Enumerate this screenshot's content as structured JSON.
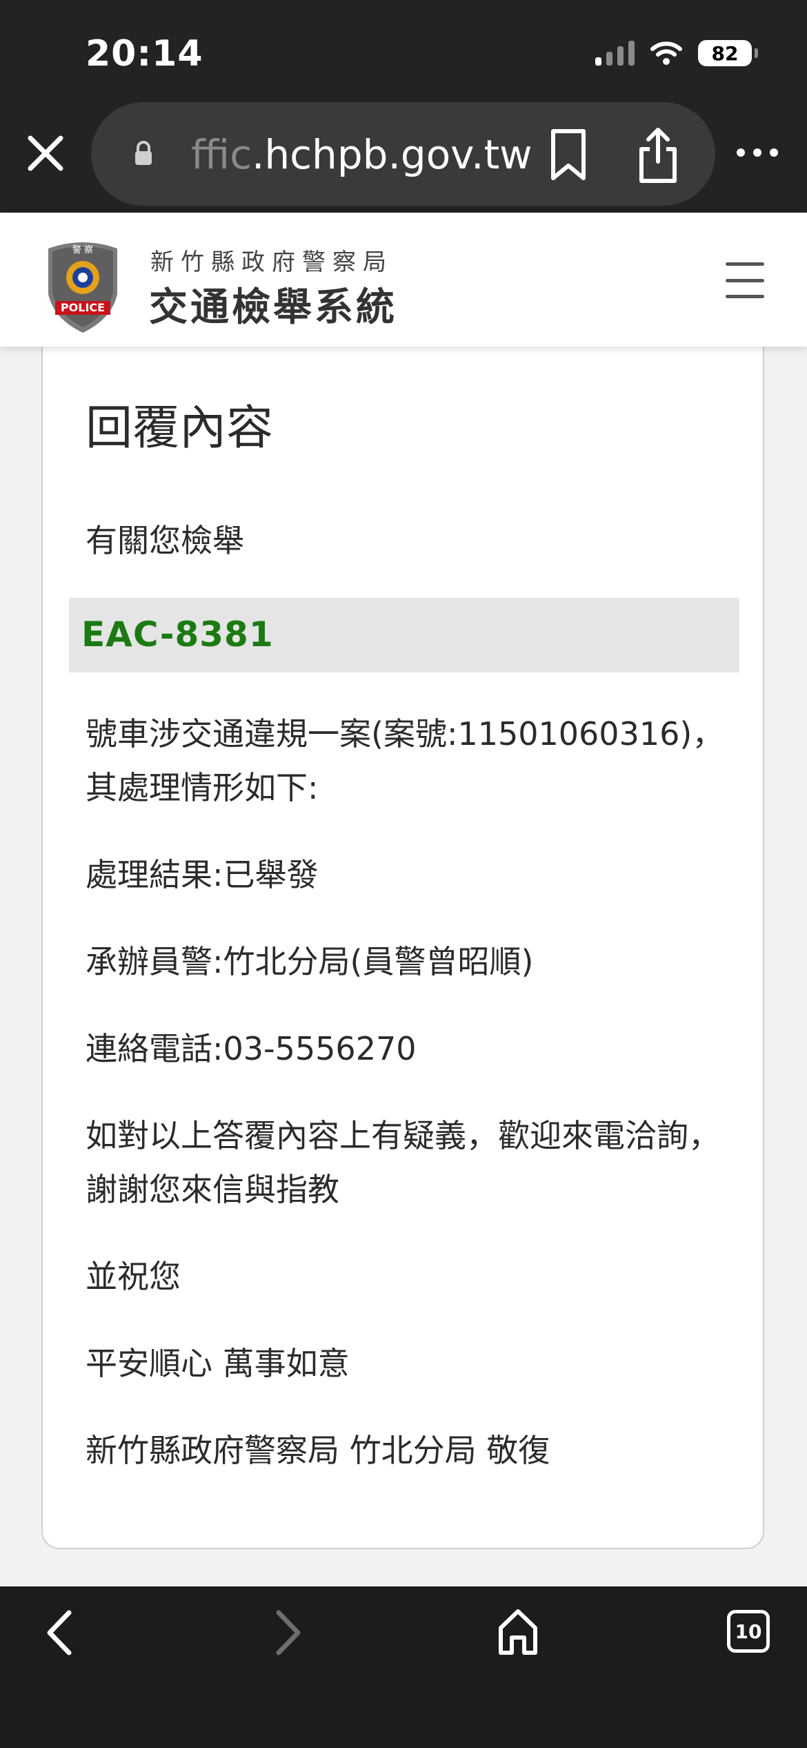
{
  "status_bar": {
    "time": "20:14",
    "battery": "82"
  },
  "browser": {
    "url_faded": "ffic",
    "url_main": ".hchpb.gov.tw",
    "tab_count": "10"
  },
  "header": {
    "org_name": "新竹縣政府警察局",
    "system_name": "交通檢舉系統",
    "logo_top_text": "警 察",
    "logo_text": "POLICE"
  },
  "reply": {
    "title": "回覆內容",
    "intro": "有關您檢舉",
    "plate": "EAC-8381",
    "case_line": "號車涉交通違規一案(案號:11501060316)，其處理情形如下:",
    "result": "處理結果:已舉發",
    "officer": "承辦員警:竹北分局(員警曾昭順)",
    "phone": "連絡電話:03-5556270",
    "inquiry": "如對以上答覆內容上有疑義，歡迎來電洽詢，謝謝您來信與指教",
    "wish_1": "並祝您",
    "wish_2": "平安順心 萬事如意",
    "signature": "新竹縣政府警察局 竹北分局 敬復"
  },
  "colors": {
    "chrome_bg": "#232324",
    "plate_green": "#1b7a12",
    "plate_bg": "#e5e5e5"
  }
}
